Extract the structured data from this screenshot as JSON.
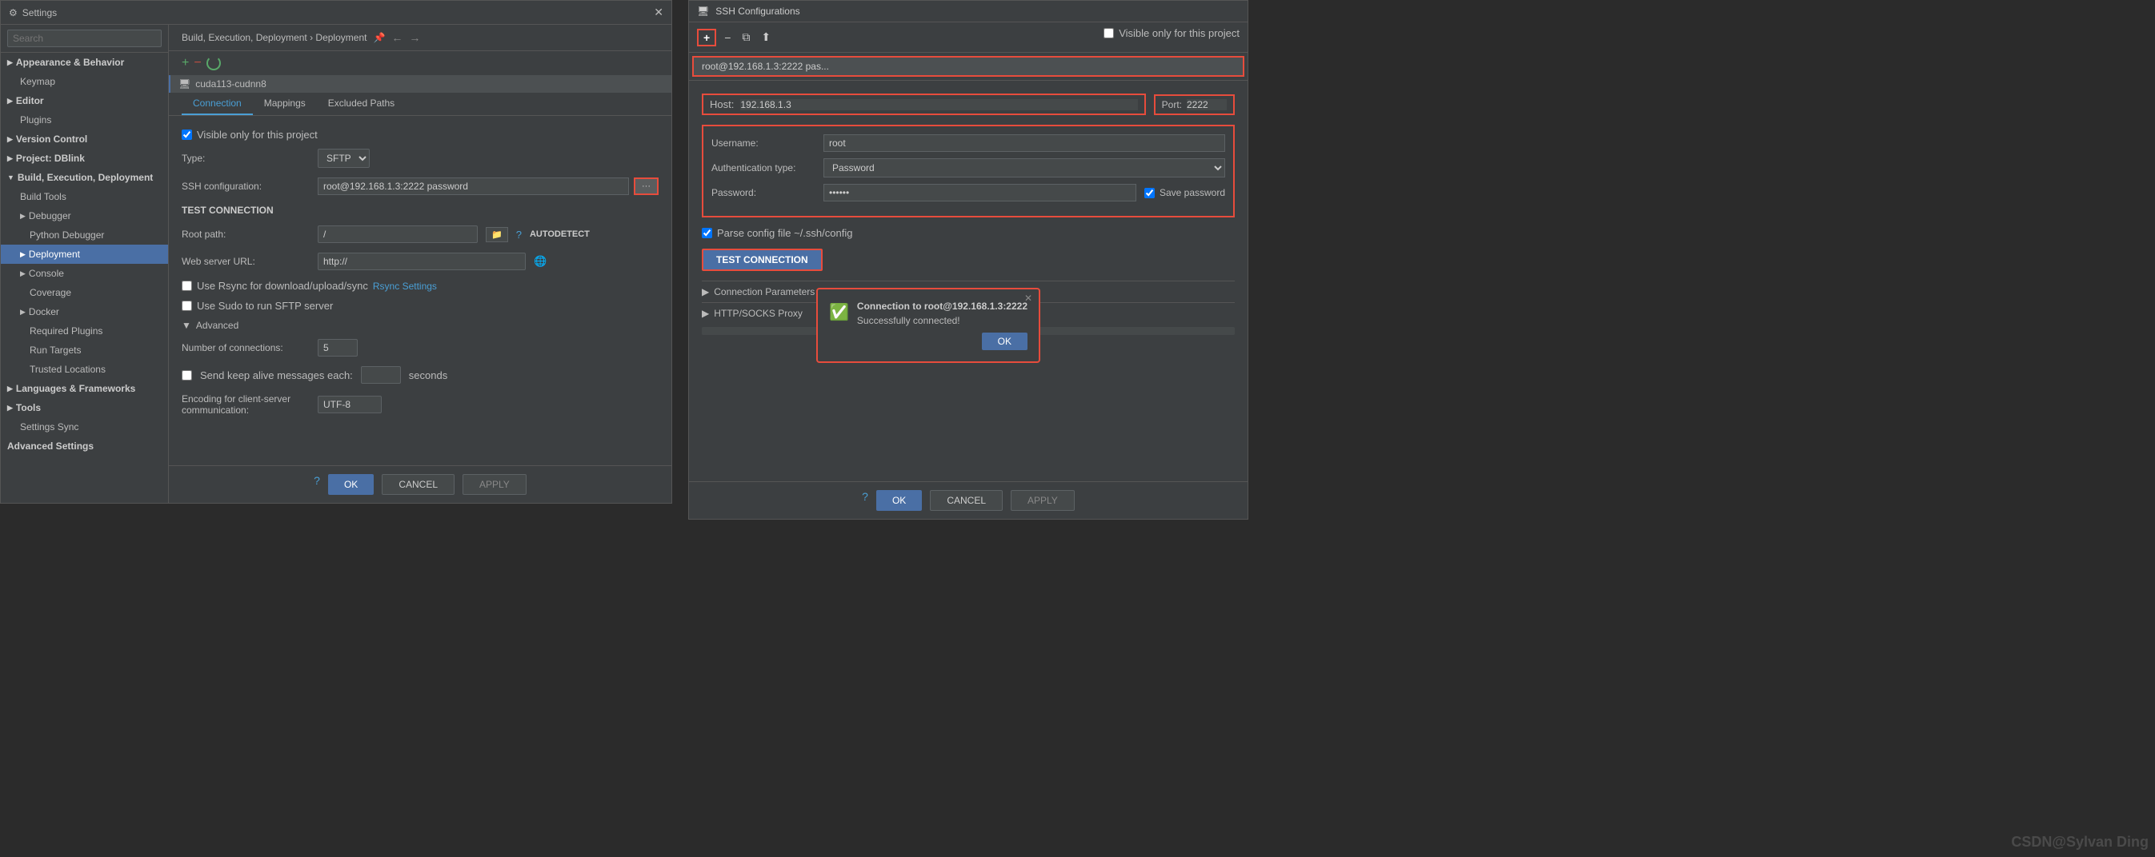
{
  "settings_window": {
    "title": "Settings",
    "breadcrumb": "Build, Execution, Deployment › Deployment",
    "pin_icon": "📌",
    "nav_back": "←",
    "nav_forward": "→"
  },
  "sidebar": {
    "search_placeholder": "Search",
    "items": [
      {
        "id": "appearance",
        "label": "Appearance & Behavior",
        "indent": 0,
        "expandable": true
      },
      {
        "id": "keymap",
        "label": "Keymap",
        "indent": 1,
        "expandable": false
      },
      {
        "id": "editor",
        "label": "Editor",
        "indent": 0,
        "expandable": true
      },
      {
        "id": "plugins",
        "label": "Plugins",
        "indent": 1,
        "expandable": false
      },
      {
        "id": "version-control",
        "label": "Version Control",
        "indent": 0,
        "expandable": true
      },
      {
        "id": "project",
        "label": "Project: DBlink",
        "indent": 0,
        "expandable": true
      },
      {
        "id": "build",
        "label": "Build, Execution, Deployment",
        "indent": 0,
        "expandable": true,
        "active": true
      },
      {
        "id": "build-tools",
        "label": "Build Tools",
        "indent": 1,
        "expandable": false
      },
      {
        "id": "debugger",
        "label": "Debugger",
        "indent": 1,
        "expandable": true
      },
      {
        "id": "python-debugger",
        "label": "Python Debugger",
        "indent": 2,
        "expandable": false
      },
      {
        "id": "deployment",
        "label": "Deployment",
        "indent": 1,
        "expandable": false,
        "highlighted": true
      },
      {
        "id": "console",
        "label": "Console",
        "indent": 1,
        "expandable": true
      },
      {
        "id": "coverage",
        "label": "Coverage",
        "indent": 2,
        "expandable": false
      },
      {
        "id": "docker",
        "label": "Docker",
        "indent": 1,
        "expandable": true
      },
      {
        "id": "required-plugins",
        "label": "Required Plugins",
        "indent": 2,
        "expandable": false
      },
      {
        "id": "run-targets",
        "label": "Run Targets",
        "indent": 2,
        "expandable": false
      },
      {
        "id": "trusted-locations",
        "label": "Trusted Locations",
        "indent": 2,
        "expandable": false
      },
      {
        "id": "languages",
        "label": "Languages & Frameworks",
        "indent": 0,
        "expandable": true
      },
      {
        "id": "tools",
        "label": "Tools",
        "indent": 0,
        "expandable": true
      },
      {
        "id": "settings-sync",
        "label": "Settings Sync",
        "indent": 1,
        "expandable": false
      },
      {
        "id": "advanced-settings",
        "label": "Advanced Settings",
        "indent": 0,
        "expandable": false
      }
    ]
  },
  "main": {
    "server_name": "cuda113-cudnn8",
    "tabs": [
      "Connection",
      "Mappings",
      "Excluded Paths"
    ],
    "active_tab": "Connection",
    "visible_only_checked": true,
    "visible_only_label": "Visible only for this project",
    "type_label": "Type:",
    "type_value": "SFTP",
    "ssh_config_label": "SSH configuration:",
    "ssh_config_value": "root@192.168.1.3:2222 password",
    "root_path_label": "Root path:",
    "root_path_value": "/",
    "web_server_label": "Web server URL:",
    "web_server_value": "http://",
    "use_rsync_label": "Use Rsync for download/upload/sync",
    "rsync_settings_link": "Rsync Settings",
    "use_sudo_label": "Use Sudo to run SFTP server",
    "advanced_label": "Advanced",
    "num_connections_label": "Number of connections:",
    "num_connections_value": "5",
    "keep_alive_label": "Send keep alive messages each:",
    "keep_alive_checked": false,
    "encoding_label": "Encoding for client-server communication:",
    "encoding_value": "UTF-8",
    "test_connection_label": "TEST CONNECTION",
    "btn_ok": "OK",
    "btn_cancel": "CANCEL",
    "btn_apply": "APPLY"
  },
  "ssh_window": {
    "title": "SSH Configurations",
    "visible_only_label": "Visible only for this project",
    "visible_only_checked": false,
    "server_list_item": "root@192.168.1.3:2222 pas...",
    "host_label": "Host:",
    "host_value": "192.168.1.3",
    "port_label": "Port:",
    "port_value": "2222",
    "username_label": "Username:",
    "username_value": "root",
    "auth_type_label": "Authentication type:",
    "auth_type_value": "Password",
    "password_label": "Password:",
    "password_value": "123456",
    "save_password_checked": true,
    "save_password_label": "Save password",
    "parse_config_checked": true,
    "parse_config_label": "Parse config file ~/.ssh/config",
    "test_connection_btn": "TEST CONNECTION",
    "connection_params_label": "Connection Parameters",
    "http_socks_label": "HTTP/SOCKS Proxy",
    "btn_ok": "OK",
    "btn_cancel": "CANCEL",
    "btn_apply": "APPLY"
  },
  "success_popup": {
    "title": "Connection to root@192.168.1.3:2222",
    "message": "Successfully connected!",
    "btn_ok": "OK"
  },
  "watermark": "CSDN@Sylvan Ding"
}
